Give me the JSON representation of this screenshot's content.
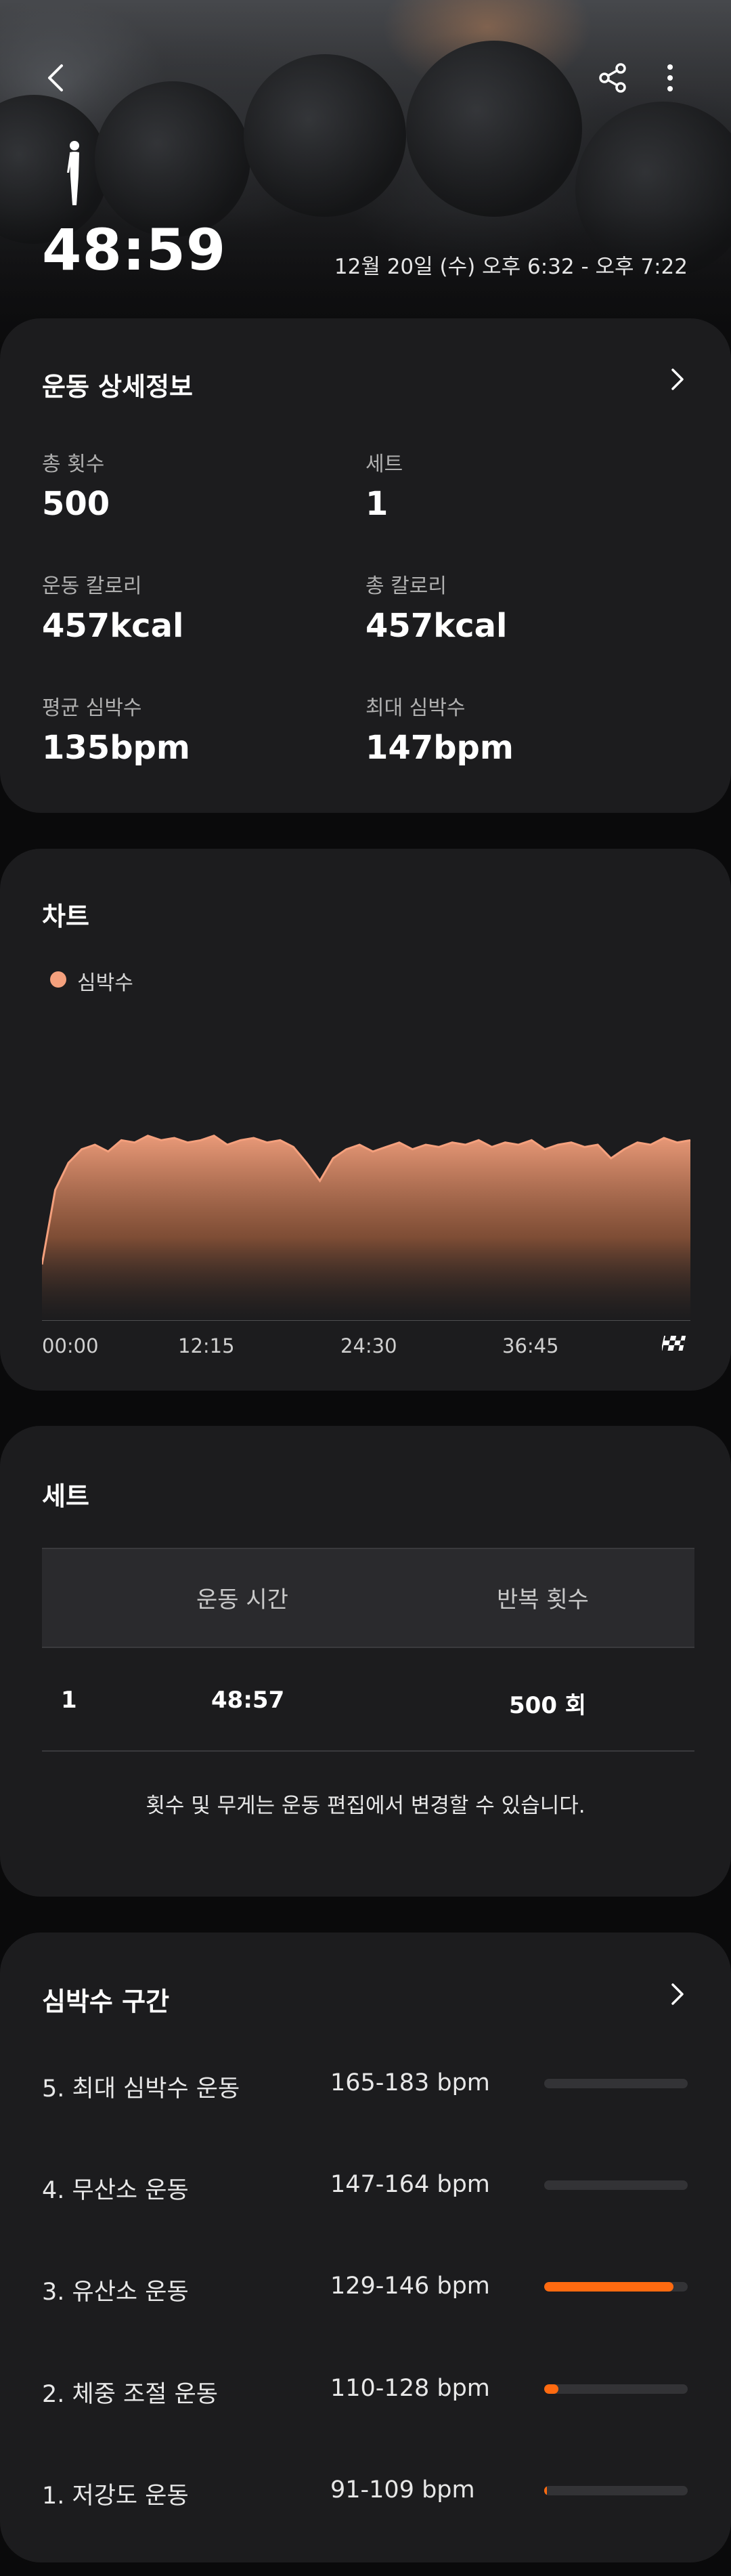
{
  "header": {
    "duration": "48:59",
    "datetime": "12월 20일 (수) 오후 6:32 - 오후 7:22"
  },
  "details": {
    "title": "운동 상세정보",
    "stats": [
      {
        "label": "총 횟수",
        "value": "500"
      },
      {
        "label": "세트",
        "value": "1"
      },
      {
        "label": "운동 칼로리",
        "value": "457kcal"
      },
      {
        "label": "총 칼로리",
        "value": "457kcal"
      },
      {
        "label": "평균 심박수",
        "value": "135bpm"
      },
      {
        "label": "최대 심박수",
        "value": "147bpm"
      }
    ]
  },
  "chart": {
    "title": "차트",
    "legend": "심박수",
    "x_ticks": [
      "00:00",
      "12:15",
      "24:30",
      "36:45"
    ]
  },
  "chart_data": {
    "type": "area",
    "title": "",
    "series": [
      {
        "name": "심박수",
        "x": [
          0,
          1,
          2,
          3,
          4,
          5,
          6,
          7,
          8,
          9,
          10,
          11,
          12,
          13,
          14,
          15,
          16,
          17,
          18,
          19,
          20,
          21,
          22,
          23,
          24,
          25,
          26,
          27,
          28,
          29,
          30,
          31,
          32,
          33,
          34,
          35,
          36,
          37,
          38,
          39,
          40,
          41,
          42,
          43,
          44,
          45,
          46,
          47,
          48,
          49
        ],
        "values": [
          85,
          118,
          130,
          136,
          138,
          135,
          140,
          139,
          142,
          140,
          141,
          139,
          140,
          142,
          138,
          140,
          141,
          139,
          140,
          137,
          130,
          122,
          132,
          136,
          138,
          135,
          137,
          139,
          136,
          138,
          137,
          139,
          138,
          140,
          137,
          139,
          138,
          140,
          136,
          138,
          139,
          137,
          138,
          132,
          136,
          139,
          138,
          141,
          139,
          140
        ]
      }
    ],
    "xlabel": "",
    "ylabel": "",
    "x_ticks": [
      "00:00",
      "12:15",
      "24:30",
      "36:45"
    ],
    "colors": {
      "fill_top": "#f4a07d",
      "line": "#f4a07d"
    }
  },
  "sets": {
    "title": "세트",
    "headers": [
      "운동 시간",
      "반복 횟수"
    ],
    "rows": [
      {
        "index": "1",
        "time": "48:57",
        "reps": "500 회"
      }
    ],
    "note": "횟수 및 무게는 운동 편집에서 변경할 수 있습니다."
  },
  "zones": {
    "title": "심박수 구간",
    "items": [
      {
        "label": "5. 최대 심박수 운동",
        "range": "165-183 bpm",
        "fraction": 0.0
      },
      {
        "label": "4. 무산소 운동",
        "range": "147-164 bpm",
        "fraction": 0.0
      },
      {
        "label": "3. 유산소 운동",
        "range": "129-146 bpm",
        "fraction": 0.9
      },
      {
        "label": "2. 체중 조절 운동",
        "range": "110-128 bpm",
        "fraction": 0.1
      },
      {
        "label": "1. 저강도 운동",
        "range": "91-109 bpm",
        "fraction": 0.02
      }
    ],
    "accent": "#ff6a10"
  },
  "icons": {
    "back": "back-arrow-icon",
    "share": "share-icon",
    "more": "more-vert-icon",
    "workout": "standing-figure-icon",
    "finish": "finish-flag-icon",
    "chevron": "chevron-right-icon"
  }
}
